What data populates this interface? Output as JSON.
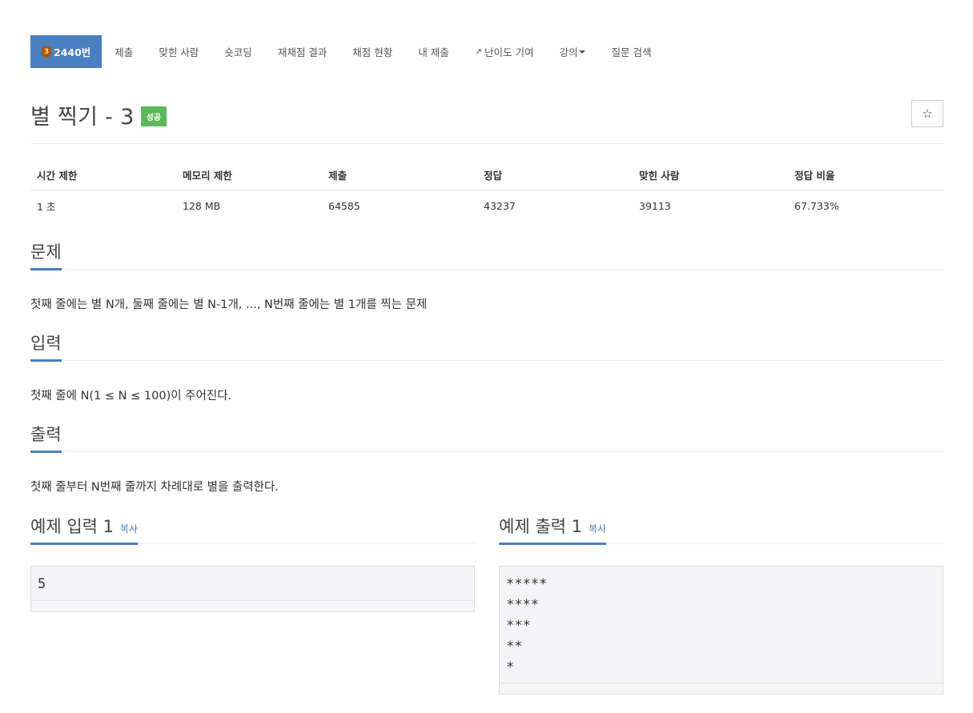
{
  "nav": {
    "tier_label": "3",
    "problem_tab": "2440번",
    "items": [
      "제출",
      "맞힌 사람",
      "숏코딩",
      "재채점 결과",
      "채점 현황",
      "내 제출",
      "난이도 기여",
      "강의",
      "질문 검색"
    ]
  },
  "problem": {
    "title": "별 찍기 - 3",
    "status": "성공",
    "star_icon": "☆"
  },
  "info": {
    "headers": [
      "시간 제한",
      "메모리 제한",
      "제출",
      "정답",
      "맞힌 사람",
      "정답 비율"
    ],
    "values": [
      "1 초",
      "128 MB",
      "64585",
      "43237",
      "39113",
      "67.733%"
    ]
  },
  "sections": {
    "problem_heading": "문제",
    "problem_text": "첫째 줄에는 별 N개, 둘째 줄에는 별 N-1개, ..., N번째 줄에는 별 1개를 찍는 문제",
    "input_heading": "입력",
    "input_text": "첫째 줄에 N(1 ≤ N ≤ 100)이 주어진다.",
    "output_heading": "출력",
    "output_text": "첫째 줄부터 N번째 줄까지 차례대로 별을 출력한다."
  },
  "samples": {
    "input_heading": "예제 입력 1",
    "output_heading": "예제 출력 1",
    "copy_label": "복사",
    "input_value": "5",
    "output_value": "*****\n****\n***\n**\n*"
  },
  "colors": {
    "accent": "#4a7fc1",
    "success": "#5cb85c",
    "tier_bronze": "#ad5600"
  }
}
